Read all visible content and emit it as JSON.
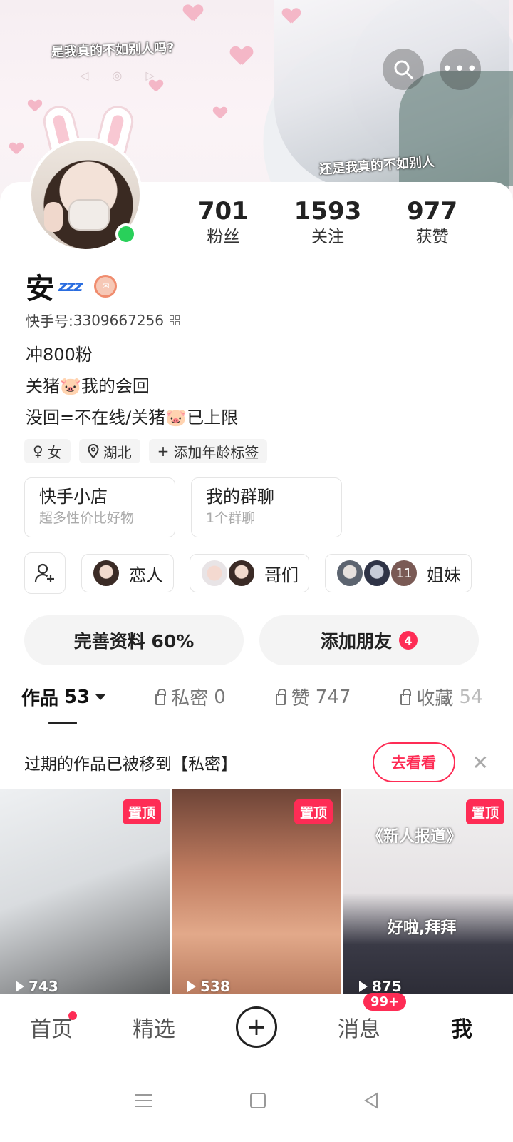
{
  "banner": {
    "lyric_top": "是我真的不如别人吗?",
    "lyric_bottom": "还是我真的不如别人"
  },
  "header": {
    "search_icon": "search-icon",
    "more_icon": "more-icon"
  },
  "stats": [
    {
      "value": "701",
      "label": "粉丝"
    },
    {
      "value": "1593",
      "label": "关注"
    },
    {
      "value": "977",
      "label": "获赞"
    }
  ],
  "profile": {
    "name": "安",
    "zzz": "zzz",
    "kuaishou_id_label": "快手号:",
    "kuaishou_id": "3309667256",
    "bio": [
      "冲800粉",
      "关猪🐷我的会回",
      "没回=不在线/关猪🐷已上限"
    ]
  },
  "tags": [
    {
      "icon": "gender-icon",
      "label": "女"
    },
    {
      "icon": "location-icon",
      "label": "湖北"
    },
    {
      "icon": "plus-icon",
      "label": "添加年龄标签"
    }
  ],
  "cards": [
    {
      "title": "快手小店",
      "subtitle": "超多性价比好物"
    },
    {
      "title": "我的群聊",
      "subtitle": "1个群聊"
    }
  ],
  "relations": [
    {
      "label": "恋人"
    },
    {
      "label": "哥们"
    },
    {
      "label": "姐妹",
      "count": "11"
    }
  ],
  "actions": {
    "complete_profile": "完善资料 60%",
    "add_friends": "添加朋友",
    "add_friends_badge": "4"
  },
  "tabs": [
    {
      "label": "作品",
      "count": "53"
    },
    {
      "label": "私密",
      "count": "0"
    },
    {
      "label": "赞",
      "count": "747"
    },
    {
      "label": "收藏",
      "count": "54"
    }
  ],
  "notice": {
    "text": "过期的作品已被移到【私密】",
    "button": "去看看"
  },
  "videos": [
    {
      "pinned": "置顶",
      "plays": "743"
    },
    {
      "pinned": "置顶",
      "plays": "538"
    },
    {
      "pinned": "置顶",
      "plays": "875",
      "title": "《新人报道》",
      "caption": "好啦,拜拜"
    }
  ],
  "bottom_nav": [
    {
      "label": "首页"
    },
    {
      "label": "精选"
    },
    {
      "label": "+"
    },
    {
      "label": "消息",
      "badge": "99+"
    },
    {
      "label": "我"
    }
  ],
  "colors": {
    "accent": "#fe2c55",
    "online": "#29d05a"
  }
}
